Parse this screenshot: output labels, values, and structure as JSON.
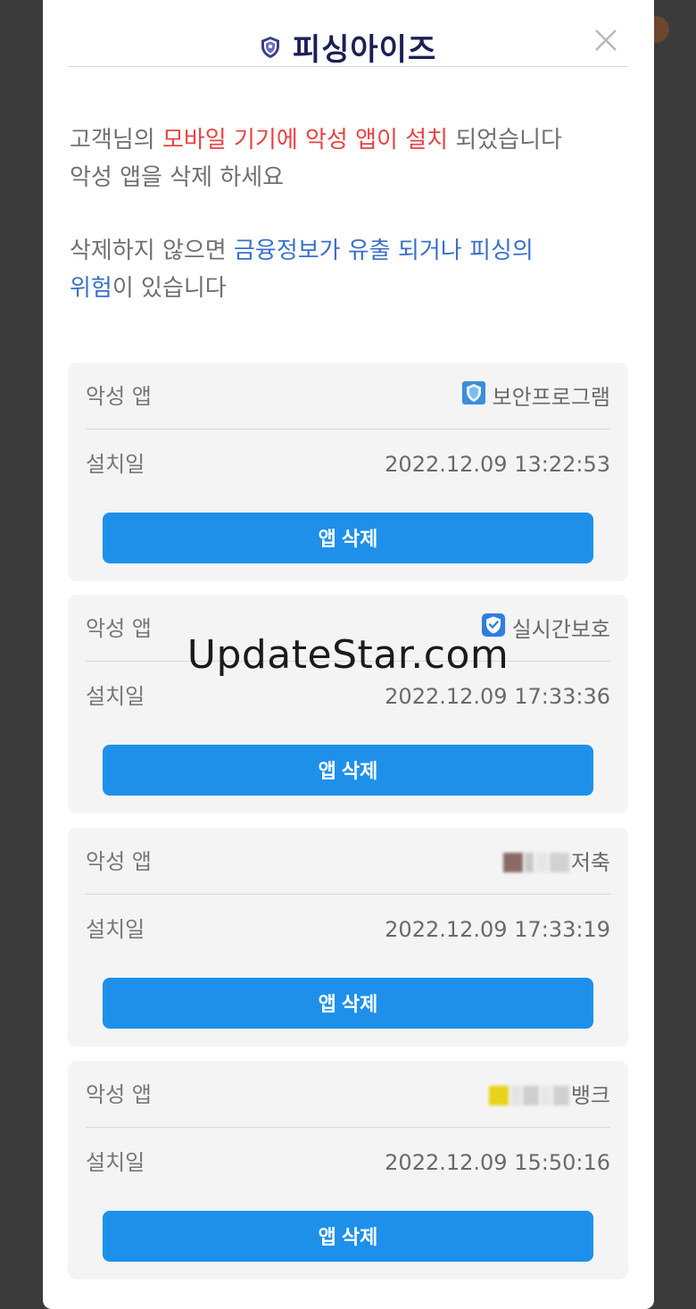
{
  "modal": {
    "title": "피싱아이즈",
    "close_icon": "close-icon",
    "title_icon": "shield-icon"
  },
  "message": {
    "line1_prefix": "고객님의 ",
    "line1_red": "모바일 기기에 악성 앱이 설치",
    "line1_suffix": " 되었습니다",
    "line2": "악성 앱을 삭제 하세요",
    "line3_prefix": "삭제하지 않으면 ",
    "line3_blue": "금융정보가 유출 되거나 피싱의",
    "line4_blue": "위험",
    "line4_suffix": "이 있습니다"
  },
  "apps": [
    {
      "label": "악성 앱",
      "name": "보안프로그램",
      "icon": "shield-app-icon",
      "date_label": "설치일",
      "date": "2022.12.09 13:22:53",
      "button": "앱 삭제"
    },
    {
      "label": "악성 앱",
      "name": "실시간보호",
      "icon": "check-shield-icon",
      "date_label": "설치일",
      "date": "2022.12.09 17:33:36",
      "button": "앱 삭제"
    },
    {
      "label": "악성 앱",
      "name": "저축",
      "icon": "blurred-bank-icon",
      "date_label": "설치일",
      "date": "2022.12.09 17:33:19",
      "button": "앱 삭제"
    },
    {
      "label": "악성 앱",
      "name": "뱅크",
      "icon": "blurred-bank-icon",
      "date_label": "설치일",
      "date": "2022.12.09 15:50:16",
      "button": "앱 삭제"
    }
  ],
  "watermark": "UpdateStar.com",
  "colors": {
    "accent": "#1e90ea",
    "warning": "#e74343",
    "link": "#3a70c9",
    "title": "#1c1f55"
  }
}
